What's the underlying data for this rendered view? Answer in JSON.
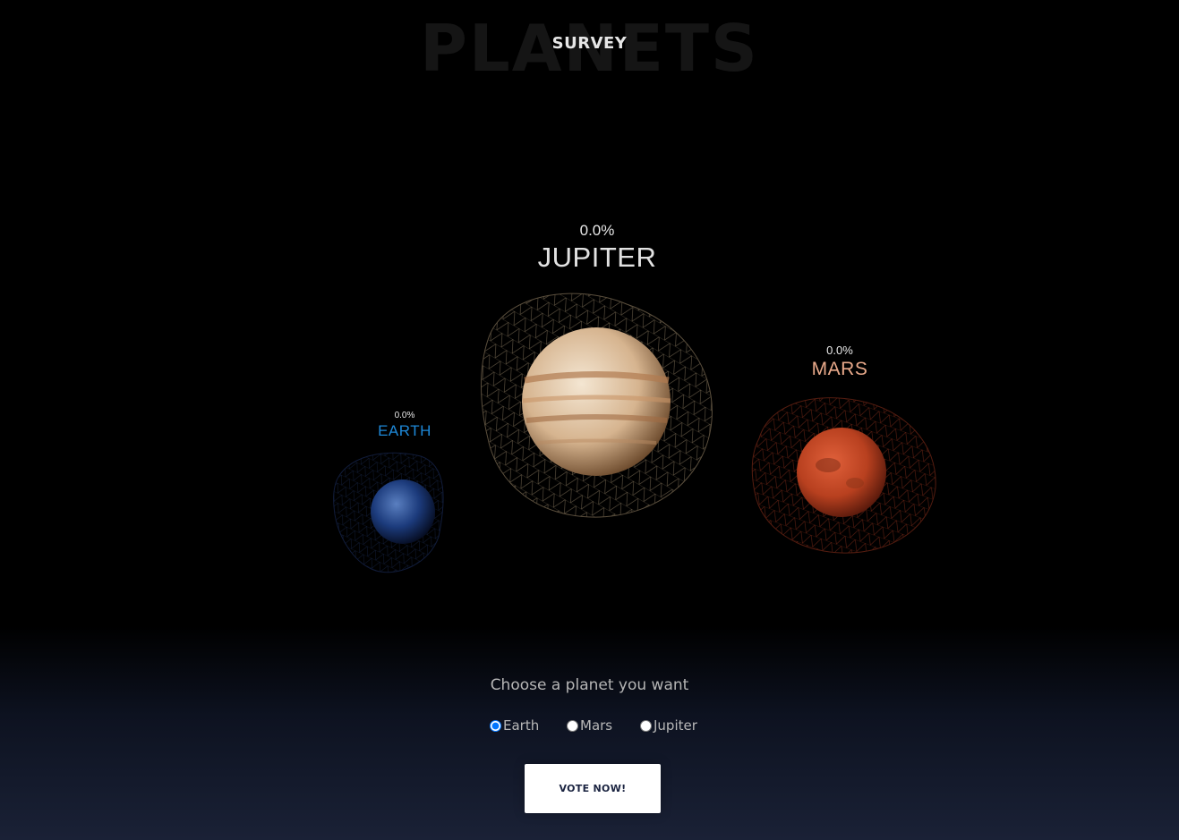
{
  "header": {
    "background_title": "PLANETS",
    "title": "SURVEY"
  },
  "planets": [
    {
      "id": "jupiter",
      "name": "JUPITER",
      "percent": "0.0%",
      "color": "#e2e2e2"
    },
    {
      "id": "mars",
      "name": "MARS",
      "percent": "0.0%",
      "color": "#e8a98a"
    },
    {
      "id": "earth",
      "name": "EARTH",
      "percent": "0.0%",
      "color": "#1e88d8"
    }
  ],
  "form": {
    "prompt": "Choose a planet you want",
    "options": [
      {
        "label": "Earth",
        "value": "earth",
        "checked": true
      },
      {
        "label": "Mars",
        "value": "mars",
        "checked": false
      },
      {
        "label": "Jupiter",
        "value": "jupiter",
        "checked": false
      }
    ],
    "submit_label": "VOTE NOW!"
  }
}
